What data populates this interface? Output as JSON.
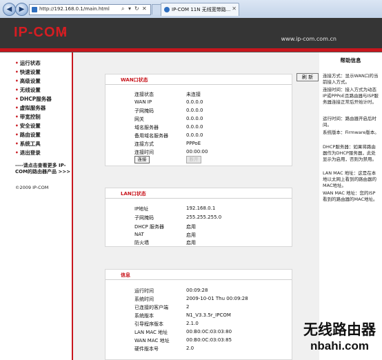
{
  "browser": {
    "address": "http://192.168.0.1/main.html",
    "tab_title": "IP-COM 11N 无线宽带路...",
    "icons": [
      "back-icon",
      "forward-icon",
      "search-icon",
      "refresh-icon",
      "stop-icon",
      "close-icon"
    ]
  },
  "header": {
    "logo": "IP-COM",
    "site_url": "www.ip-com.com.cn",
    "colors": {
      "brand_red": "#c8161d",
      "header_bg": "#353535"
    }
  },
  "nav": {
    "items": [
      "运行状态",
      "快速设置",
      "高级设置",
      "无线设置",
      "DHCP服务器",
      "虚拟服务器",
      "带宽控制",
      "安全设置",
      "路由设置",
      "系统工具",
      "退出登录"
    ],
    "more_text": "----请点击查看更多 IP-COM的路由器产品 >>>",
    "copyright": "©2009 IP-COM"
  },
  "main": {
    "refresh_label": "刷 新",
    "wan": {
      "title": "WAN口状态",
      "rows": [
        {
          "label": "连接状态",
          "value": "未连接"
        },
        {
          "label": "WAN IP",
          "value": "0.0.0.0"
        },
        {
          "label": "子网掩码",
          "value": "0.0.0.0"
        },
        {
          "label": "网关",
          "value": "0.0.0.0"
        },
        {
          "label": "域名服务器",
          "value": "0.0.0.0"
        },
        {
          "label": "备用域名服务器",
          "value": "0.0.0.0"
        },
        {
          "label": "连接方式",
          "value": "PPPoE"
        },
        {
          "label": "连接时间",
          "value": "00:00:00"
        }
      ],
      "connect_label": "连接",
      "disconnect_label": "断开"
    },
    "lan": {
      "title": "LAN口状态",
      "rows": [
        {
          "label": "IP地址",
          "value": "192.168.0.1"
        },
        {
          "label": "子网掩码",
          "value": "255.255.255.0"
        },
        {
          "label": "DHCP 服务器",
          "value": "启用"
        },
        {
          "label": "NAT",
          "value": "启用"
        },
        {
          "label": "防火墙",
          "value": "启用"
        }
      ]
    },
    "info": {
      "title": "信息",
      "rows": [
        {
          "label": "运行时间",
          "value": "00:09:28"
        },
        {
          "label": "系统时间",
          "value": "2009-10-01 Thu 00:09:28"
        },
        {
          "label": "已连接的客户端",
          "value": "2"
        },
        {
          "label": "系统版本",
          "value": "N1_V3.3.5r_IPCOM"
        },
        {
          "label": "引导程序版本",
          "value": "2.1.0"
        },
        {
          "label": "LAN MAC 地址",
          "value": "00:B0:0C:03:03:80"
        },
        {
          "label": "WAN MAC 地址",
          "value": "00:B0:0C:03:03:85"
        },
        {
          "label": "硬件版本号",
          "value": "2.0"
        }
      ]
    }
  },
  "help": {
    "title": "帮助信息",
    "paragraphs": [
      "连接方式：显示WAN口的当前接入方式。",
      "连接时间：接入方式为动态IP或PPPoE且路由器与ISP服务器连接正常后开始计时。",
      "运行时间：路由器开启后时间。",
      "系统版本：Firmware版本。",
      "DHCP服务器：如果将路由器作为DHCP服务器，此处显示为启用，否则为禁用。",
      "LAN MAC 地址：这是在本地以太网上看到的路由器的MAC地址。",
      "WAN MAC 地址：您的ISP看到的路由器的MAC地址。"
    ]
  },
  "watermark": {
    "cn": "无线路由器",
    "url": "nbahi.com"
  }
}
